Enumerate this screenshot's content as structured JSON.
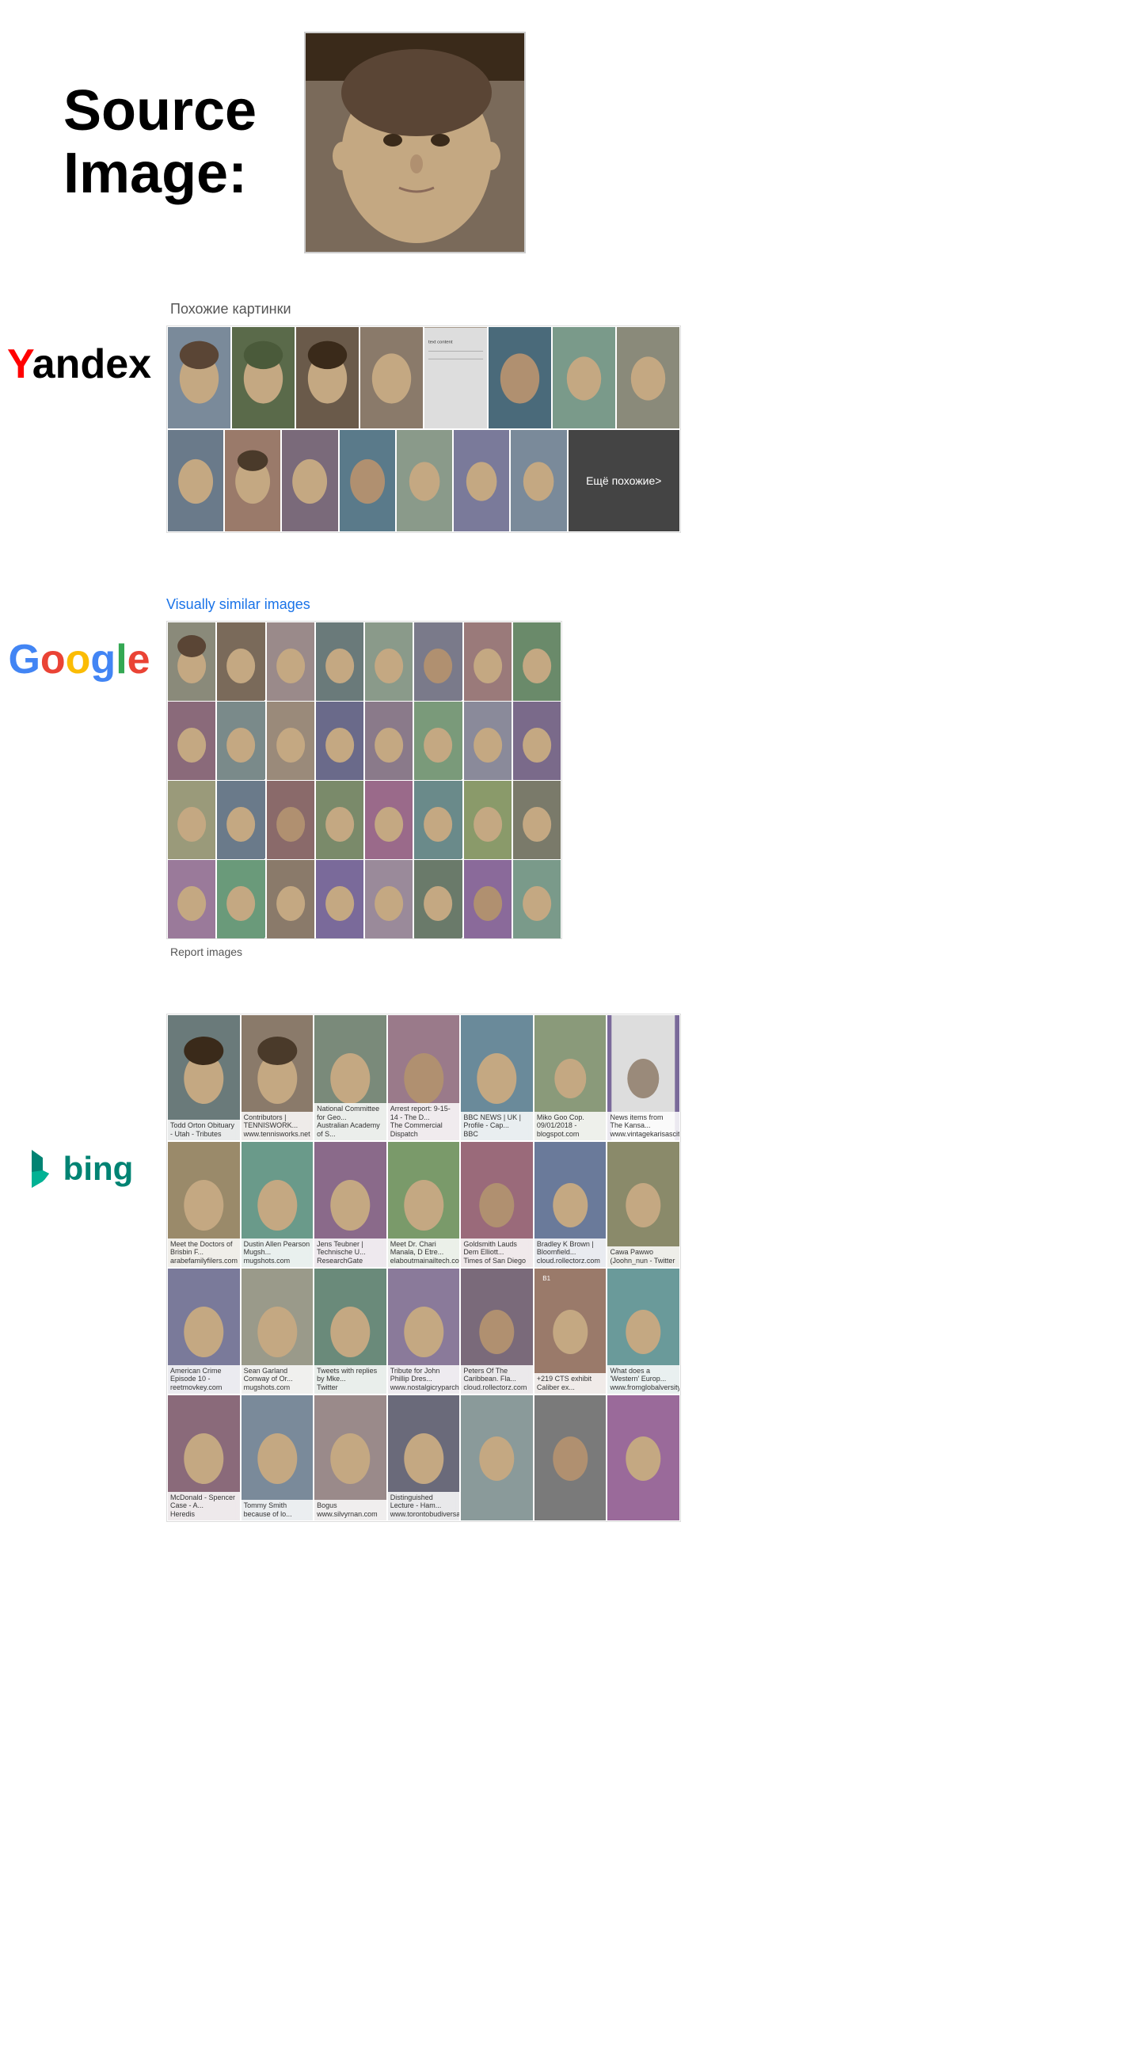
{
  "source": {
    "title_line1": "Source",
    "title_line2": "Image:"
  },
  "yandex": {
    "logo_y": "Y",
    "logo_rest": "andex",
    "section_label": "Похожие картинки",
    "more_button": "Ещё похожие"
  },
  "google": {
    "logo": "Google",
    "section_label": "Visually similar images",
    "report_link": "Report images"
  },
  "bing": {
    "logo_text": "bing",
    "captions": [
      "Todd Orton Obituary - Utah - Tributes",
      "Contributors | TENNISWORK... www.tennisworks.net",
      "National Committee for Geo... Australian Academy of S...",
      "Arrest report: 9-15-14 - The D... The Commercial Dispatch",
      "BBC NEWS | UK | Profile - Cap... BBC",
      "News Items from The Kansa... www.vintagekarisascity.c...",
      "Meet the Doctors of Brisbin F... arabefamilyfilers.com",
      "Dustin Allen Pearson Mugsh... mugshots.com",
      "Jens Teubner | Technische U... ResearchGate",
      "Meet Dr. Chari Manala, D Etre... elaboutmainailtech.com",
      "Goldsmith Lauds Dem Elliott... Times of San Diego",
      "Bradley K Brown | Bloomfield... cloud.rollectorz.com",
      "Cawa Pawwo (Joohn_nun - Twitter",
      "American Crime Episode 10 - reetmovkey.com",
      "Sean Garland Conway of Or... mugshots.com",
      "Tweets with replies by Mke... Twitter",
      "Tribute for John Phillip Dres... www.nostalgicryparchme...",
      "Peters Of The Caribbean. Fla... cloud.rollectorz.com",
      "+219 CTS exhibit Caliber ex...",
      "What does a 'Western' Europ... www.fromglobalversity.c...",
      "McDonald - Spencer Case - A... Heredis",
      "Tommy Smith because of lo...",
      "Bogus www.silvyrnan.com",
      "Distinguished Lecture - Ham... www.torontobudiversally.c..."
    ]
  }
}
